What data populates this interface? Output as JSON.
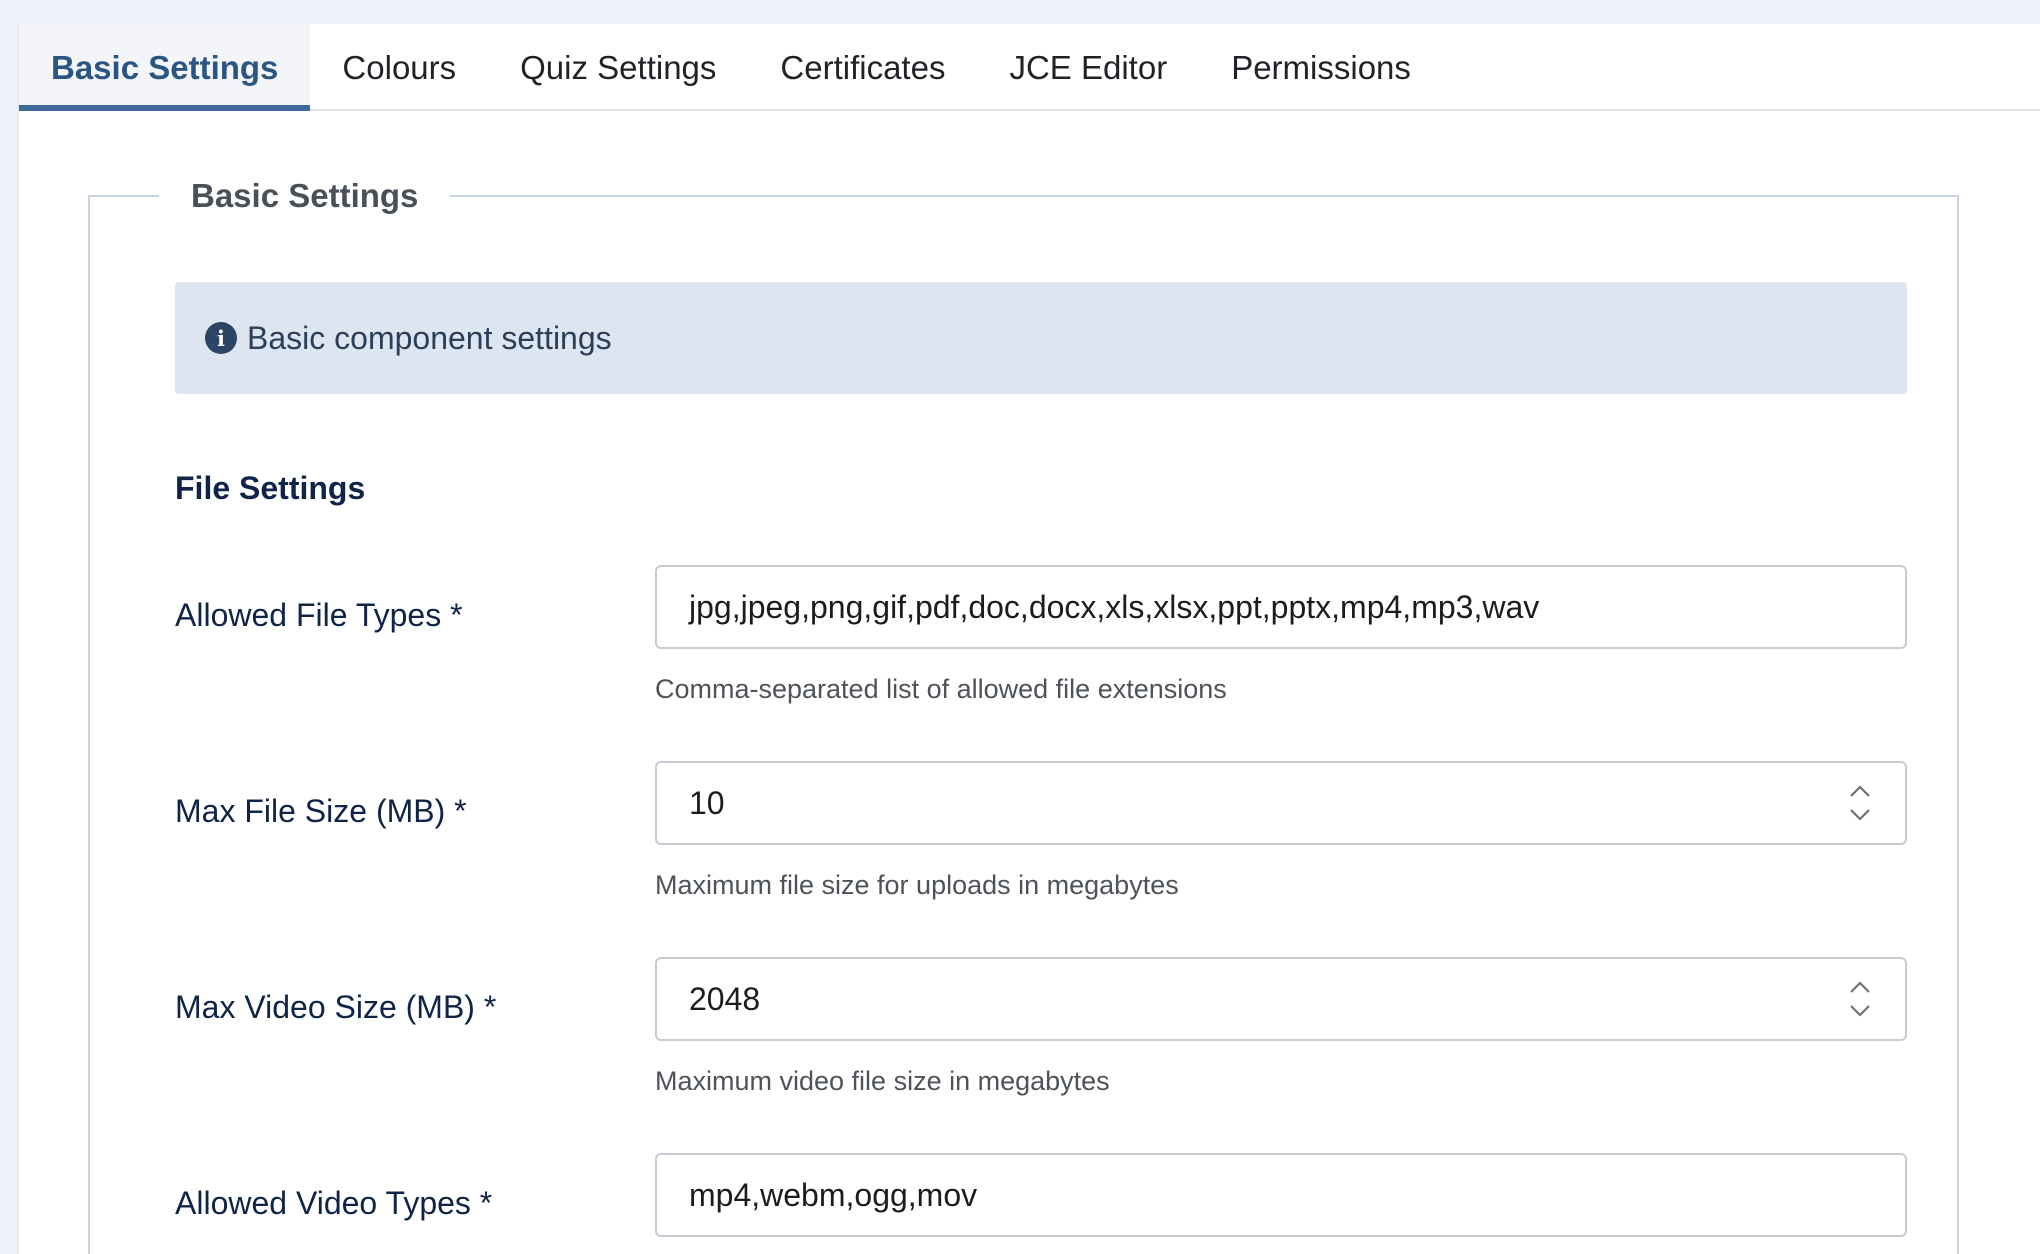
{
  "tabs": [
    {
      "label": "Basic Settings",
      "active": true
    },
    {
      "label": "Colours",
      "active": false
    },
    {
      "label": "Quiz Settings",
      "active": false
    },
    {
      "label": "Certificates",
      "active": false
    },
    {
      "label": "JCE Editor",
      "active": false
    },
    {
      "label": "Permissions",
      "active": false
    }
  ],
  "fieldset": {
    "legend": "Basic Settings",
    "alert": {
      "icon": "info-icon",
      "icon_glyph": "i",
      "text": "Basic component settings"
    },
    "section_title": "File Settings"
  },
  "fields": {
    "allowed_file_types": {
      "label": "Allowed File Types *",
      "value": "jpg,jpeg,png,gif,pdf,doc,docx,xls,xlsx,ppt,pptx,mp4,mp3,wav",
      "help": "Comma-separated list of allowed file extensions"
    },
    "max_file_size": {
      "label": "Max File Size (MB) *",
      "value": "10",
      "help": "Maximum file size for uploads in megabytes"
    },
    "max_video_size": {
      "label": "Max Video Size (MB) *",
      "value": "2048",
      "help": "Maximum video file size in megabytes"
    },
    "allowed_video_types": {
      "label": "Allowed Video Types *",
      "value": "mp4,webm,ogg,mov"
    }
  },
  "colors": {
    "active_tab": "#2a5583",
    "alert_bg": "#dde5f0",
    "label": "#0f2446"
  }
}
